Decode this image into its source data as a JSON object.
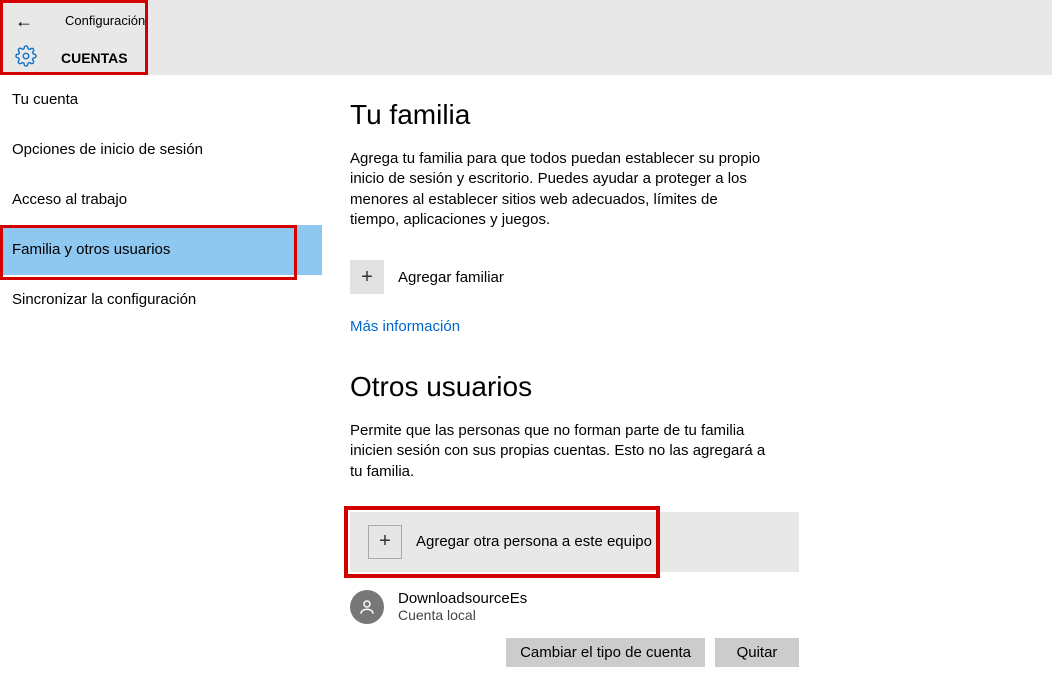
{
  "header": {
    "config_label": "Configuración",
    "accounts_label": "CUENTAS"
  },
  "sidebar": {
    "items": [
      {
        "label": "Tu cuenta"
      },
      {
        "label": "Opciones de inicio de sesión"
      },
      {
        "label": "Acceso al trabajo"
      },
      {
        "label": "Familia y otros usuarios"
      },
      {
        "label": "Sincronizar la configuración"
      }
    ]
  },
  "family": {
    "title": "Tu familia",
    "desc": "Agrega tu familia para que todos puedan establecer su propio inicio de sesión y escritorio. Puedes ayudar a proteger a los menores al establecer sitios web adecuados, límites de tiempo, aplicaciones y juegos.",
    "add_label": "Agregar familiar",
    "link": "Más información"
  },
  "others": {
    "title": "Otros usuarios",
    "desc": "Permite que las personas que no forman parte de tu familia inicien sesión con sus propias cuentas. Esto no las agregará a tu familia.",
    "add_label": "Agregar otra persona a este equipo",
    "user": {
      "name": "DownloadsourceEs",
      "type": "Cuenta local"
    },
    "change_btn": "Cambiar el tipo de cuenta",
    "remove_btn": "Quitar"
  }
}
